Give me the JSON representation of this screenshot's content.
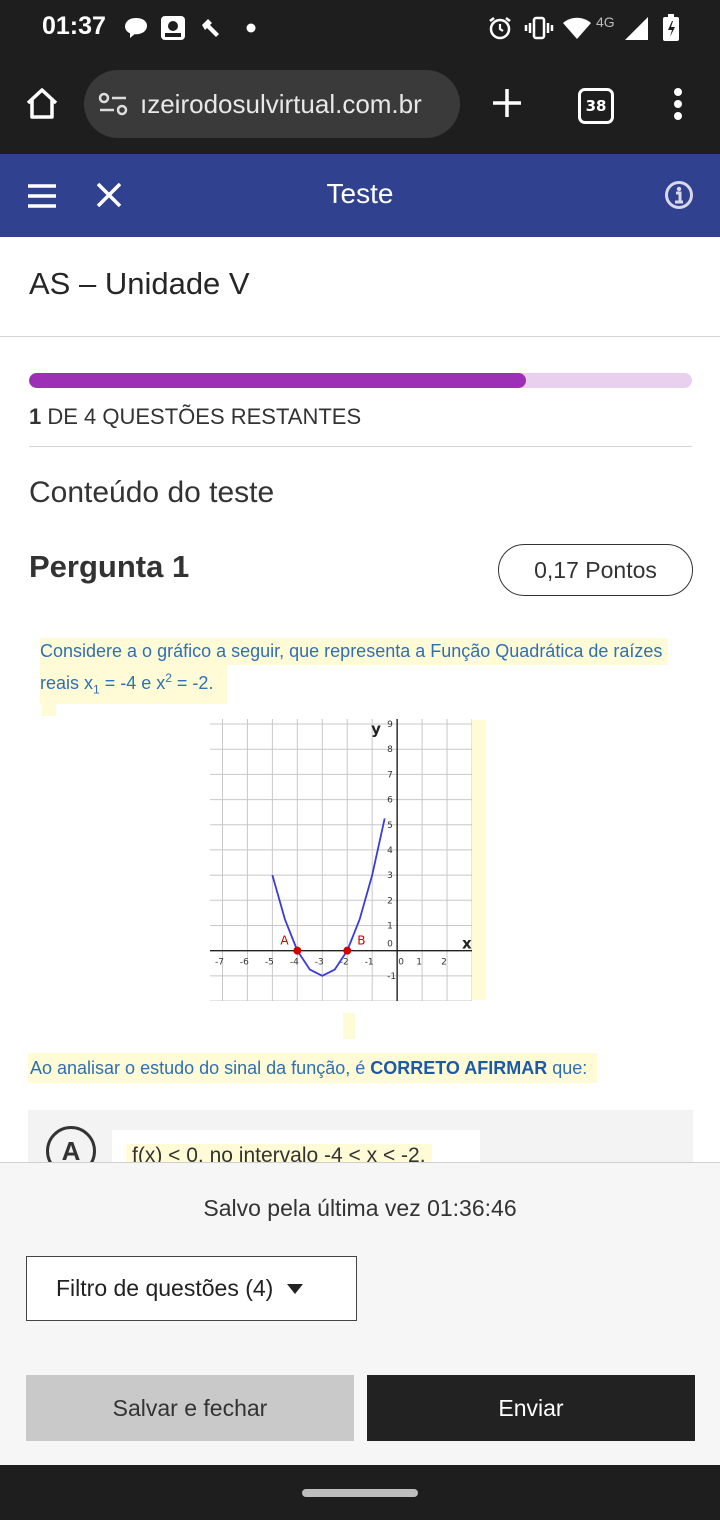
{
  "status_bar": {
    "time": "01:37",
    "network": "4G",
    "icons": [
      "chat-bubble-icon",
      "photo-icon",
      "tools-icon",
      "dot-icon",
      "alarm-icon",
      "vibrate-icon",
      "wifi-icon",
      "signal-icon",
      "battery-icon"
    ]
  },
  "browser": {
    "url": "ızeirodosulvirtual.com.br",
    "tab_count": "38",
    "icons": [
      "home-icon",
      "site-settings-icon",
      "new-tab-icon",
      "tabs-icon",
      "menu-dots-icon"
    ]
  },
  "app_header": {
    "title": "Teste",
    "icons": [
      "hamburger-menu-icon",
      "close-icon",
      "info-icon"
    ],
    "color": "#30418f"
  },
  "page": {
    "title": "AS – Unidade V",
    "progress_fraction": 0.75,
    "remaining_count": "1",
    "remaining_text": " DE 4 QUESTÕES RESTANTES",
    "content_heading": "Conteúdo do teste"
  },
  "question": {
    "title": "Pergunta 1",
    "points": "0,17 Pontos",
    "text_line1": "Considere a o gráfico a seguir, que representa a Função Quadrática de raízes",
    "text_line2_prefix": "reais x",
    "text_line2_sub": "1",
    "text_line2_mid": " = -4 e x",
    "text_line2_sup": "2",
    "text_line2_suffix": " = -2.",
    "prompt_prefix": "Ao analisar o estudo do sinal da função, é ",
    "prompt_bold": "CORRETO AFIRMAR",
    "prompt_suffix": " que:",
    "option_letter": "A",
    "option_text": "f(x) < 0, no intervalo -4 < x < -2."
  },
  "chart_data": {
    "type": "line",
    "series": [
      {
        "x": [
          -5,
          -4.5,
          -4,
          -3.5,
          -3,
          -2.5,
          -2,
          -1.5,
          -1,
          -0.5
        ],
        "y": [
          3,
          1.25,
          0,
          -0.75,
          -1,
          -0.75,
          0,
          1.25,
          3,
          5.25
        ]
      }
    ],
    "points": [
      {
        "label": "A",
        "x": -4,
        "y": 0
      },
      {
        "label": "B",
        "x": -2,
        "y": 0
      }
    ],
    "x_ticks": [
      "-7",
      "-6",
      "-5",
      "-4",
      "-3",
      "-2",
      "-1",
      "0",
      "1",
      "2"
    ],
    "y_ticks": [
      "-1",
      "0",
      "1",
      "2",
      "3",
      "4",
      "5",
      "6",
      "7",
      "8",
      "9"
    ],
    "xlabel": "x",
    "ylabel": "y",
    "xlim": [
      -7.5,
      3
    ],
    "ylim": [
      -2,
      9.2
    ],
    "grid": true,
    "line_color": "#3b3bdc",
    "point_color": "#d00000"
  },
  "footer": {
    "saved_text": "Salvo pela última vez 01:36:46",
    "filter_label": "Filtro de questões (4)",
    "save_close_label": "Salvar e fechar",
    "send_label": "Enviar"
  }
}
